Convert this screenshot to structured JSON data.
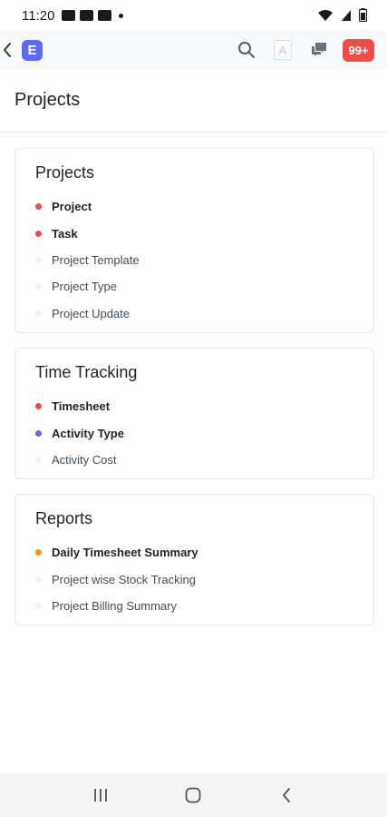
{
  "status": {
    "time": "11:20"
  },
  "app": {
    "logo_letter": "E",
    "avatar_letter": "A",
    "notification_count": "99+"
  },
  "page": {
    "title": "Projects"
  },
  "sections": [
    {
      "title": "Projects",
      "items": [
        {
          "label": "Project",
          "dot": "#ef4c4c",
          "bold": true
        },
        {
          "label": "Task",
          "dot": "#ef4c4c",
          "bold": true
        },
        {
          "label": "Project Template",
          "dot": "#f1f2f4",
          "bold": false
        },
        {
          "label": "Project Type",
          "dot": "#f1f2f4",
          "bold": false
        },
        {
          "label": "Project Update",
          "dot": "#f1f2f4",
          "bold": false
        }
      ]
    },
    {
      "title": "Time Tracking",
      "items": [
        {
          "label": "Timesheet",
          "dot": "#ef4c4c",
          "bold": true
        },
        {
          "label": "Activity Type",
          "dot": "#5c6bf2",
          "bold": true
        },
        {
          "label": "Activity Cost",
          "dot": "#f1f2f4",
          "bold": false
        }
      ]
    },
    {
      "title": "Reports",
      "items": [
        {
          "label": "Daily Timesheet Summary",
          "dot": "#f7931e",
          "bold": true
        },
        {
          "label": "Project wise Stock Tracking",
          "dot": "#f1f2f4",
          "bold": false
        },
        {
          "label": "Project Billing Summary",
          "dot": "#f1f2f4",
          "bold": false
        }
      ]
    }
  ],
  "icons": {
    "back": "chevron-left-icon",
    "search": "search-icon",
    "chat": "chat-icon",
    "nav_recent": "recent-apps-icon",
    "nav_home": "home-icon",
    "nav_back": "back-icon"
  }
}
